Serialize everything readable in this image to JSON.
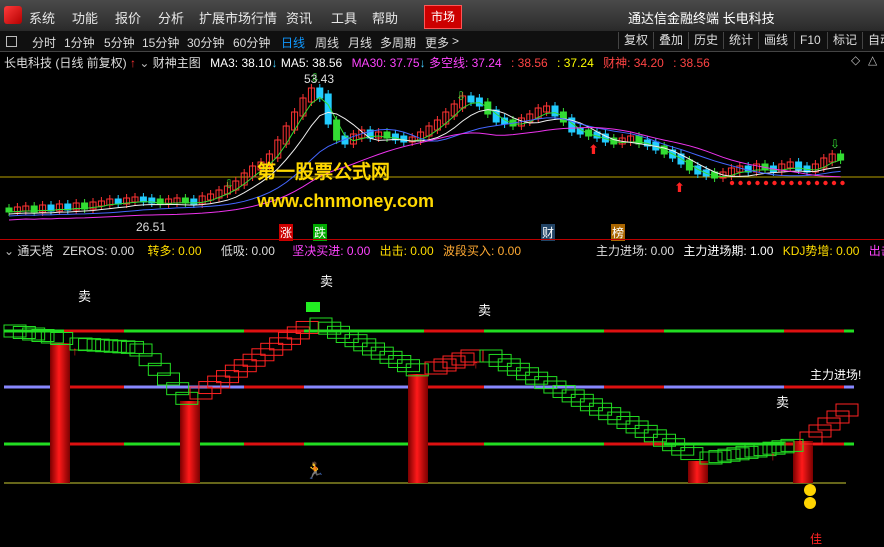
{
  "menu": {
    "items": [
      "系统",
      "功能",
      "报价",
      "分析",
      "扩展市场行情",
      "资讯",
      "工具",
      "帮助"
    ],
    "market": "市场",
    "brand": "通达信金融终端  长电科技"
  },
  "periods": {
    "items": [
      "分时",
      "1分钟",
      "5分钟",
      "15分钟",
      "30分钟",
      "60分钟",
      "日线",
      "周线",
      "月线",
      "多周期",
      "更多"
    ],
    "active": "日线",
    "more_arrow": ">"
  },
  "toolbar": [
    "复权",
    "叠加",
    "历史",
    "统计",
    "画线",
    "F10",
    "标记",
    "自动"
  ],
  "main_header": {
    "title": "长电科技 (日线 前复权)",
    "indicator": "财神主图",
    "ma3": "MA3: 38.10",
    "ma5": "MA5: 38.56",
    "ma30": "MA30: 37.75",
    "duokong": "多空线: 37.24",
    "v1": ": 38.56",
    "v2": ": 37.24",
    "caishen": "财神: 34.20",
    "v3": ": 38.56",
    "colors": {
      "ma3": "#ffffff",
      "ma5": "#ffffff",
      "ma30": "#ff44ff",
      "duokong": "#ff44ff",
      "v1": "#ff4444",
      "v2": "#ffff00",
      "caishen": "#ff4444",
      "v3": "#ff4444"
    }
  },
  "price_labels": {
    "high": "53.43",
    "low": "26.51"
  },
  "tags": [
    "涨",
    "跌",
    "财",
    "榜"
  ],
  "watermark": {
    "line1": "第一股票公式网",
    "line2": "www.chnmoney.com"
  },
  "sub_header": {
    "name": "通天塔",
    "zeros": "ZEROS: 0.00",
    "zhuanduo": "转多: 0.00",
    "dixi": "低吸: 0.00",
    "jianjue": "坚决买进: 0.00",
    "chuji": "出击: 0.00",
    "boduan": "波段买入: 0.00",
    "zhuli": "主力进场: 0.00",
    "zhulip": "主力进场期: 1.00",
    "kdj": "KDJ势增: 0.00",
    "chu": "出击"
  },
  "sub_labels": {
    "sell": "卖",
    "zhulijinchang": "主力进场!",
    "jia": "佳"
  }
}
